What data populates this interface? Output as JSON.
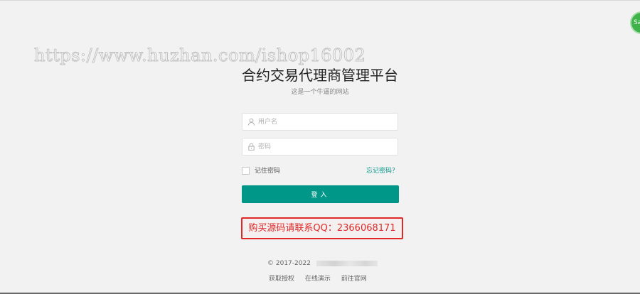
{
  "watermark": "https://www.huzhan.com/ishop16002",
  "corner_badge": "Sa",
  "header": {
    "title": "合约交易代理商管理平台",
    "subtitle": "这是一个牛逼的网站"
  },
  "form": {
    "username_placeholder": "用户名",
    "password_placeholder": "密码",
    "remember_label": "记住密码",
    "forgot_label": "忘记密码？",
    "login_label": "登入"
  },
  "promo": "购买源码请联系QQ：2366068171",
  "footer": {
    "copyright": "© 2017-2022",
    "links": [
      "获取授权",
      "在线演示",
      "前往官网"
    ]
  },
  "colors": {
    "accent": "#009688",
    "promo_red": "#e02828",
    "background": "#f2f2f2"
  },
  "icons": {
    "username": "user-icon",
    "password": "lock-icon"
  }
}
